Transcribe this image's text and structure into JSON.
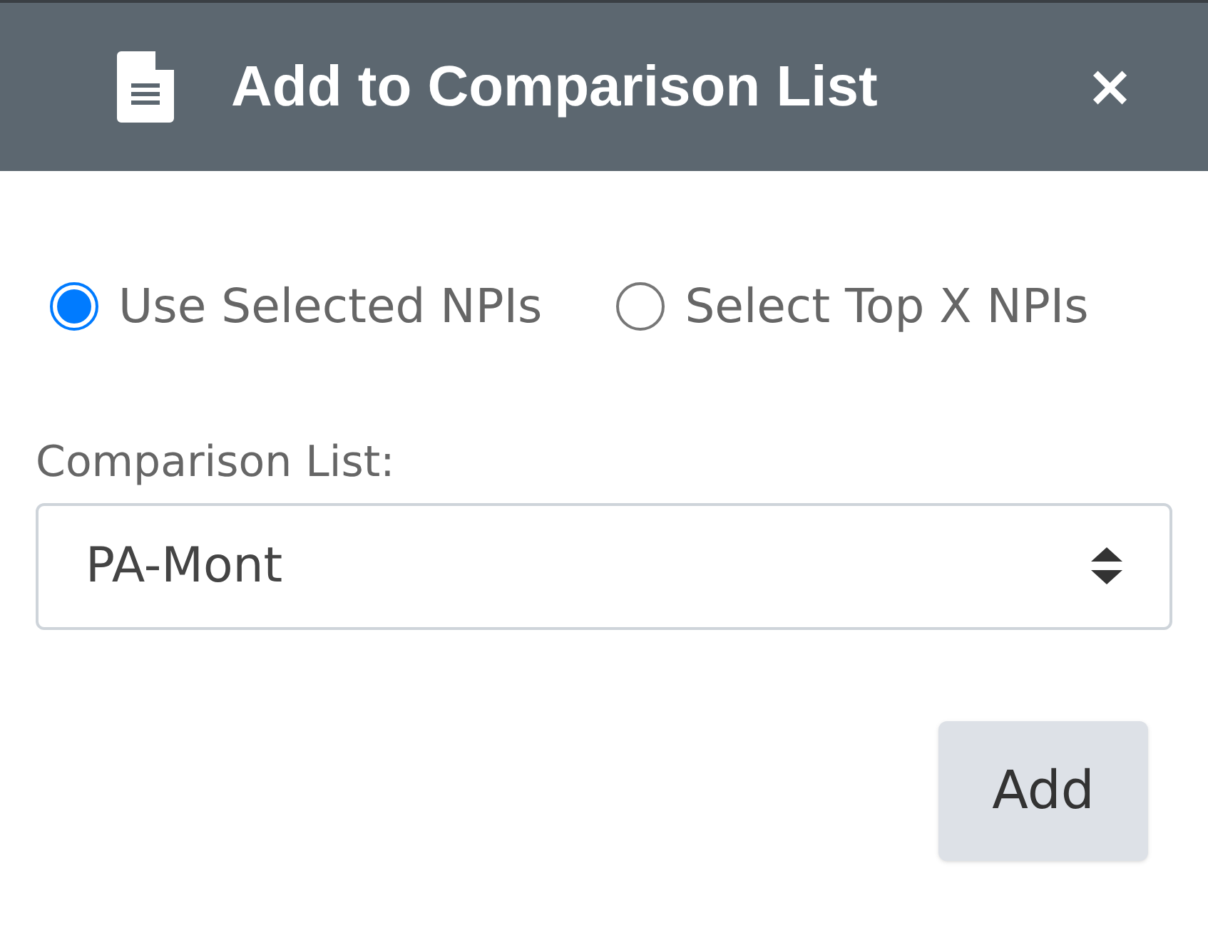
{
  "dialog": {
    "title": "Add to Comparison List",
    "close": "×"
  },
  "mode_options": [
    {
      "label": "Use Selected NPIs",
      "selected": true
    },
    {
      "label": "Select Top X NPIs",
      "selected": false
    }
  ],
  "comparison_list": {
    "label": "Comparison List:",
    "value": "PA-Mont"
  },
  "buttons": [
    "Add"
  ]
}
